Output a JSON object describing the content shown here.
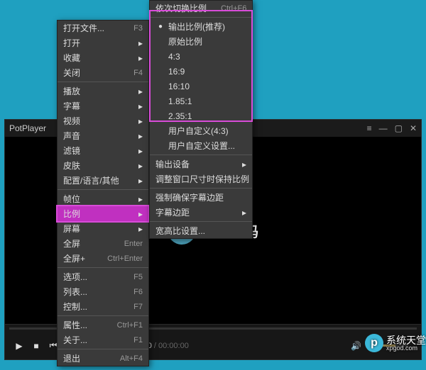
{
  "player": {
    "title": "PotPlayer",
    "logo_text": "完美解码",
    "time_current": "00:00:00",
    "time_duration": "00:00:00"
  },
  "menu1": {
    "items": [
      {
        "label": "打开文件...",
        "shortcut": "F3"
      },
      {
        "label": "打开",
        "submenu": true
      },
      {
        "label": "收藏",
        "submenu": true
      },
      {
        "label": "关闭",
        "shortcut": "F4"
      }
    ],
    "items2": [
      {
        "label": "播放",
        "submenu": true
      },
      {
        "label": "字幕",
        "submenu": true
      },
      {
        "label": "视频",
        "submenu": true
      },
      {
        "label": "声音",
        "submenu": true
      },
      {
        "label": "滤镜",
        "submenu": true
      },
      {
        "label": "皮肤",
        "submenu": true
      },
      {
        "label": "配置/语言/其他",
        "submenu": true
      }
    ],
    "items3": [
      {
        "label": "帧位",
        "submenu": true
      },
      {
        "label": "比例",
        "submenu": true,
        "highlight": true
      },
      {
        "label": "屏幕",
        "submenu": true
      },
      {
        "label": "全屏",
        "shortcut": "Enter"
      },
      {
        "label": "全屏+",
        "shortcut": "Ctrl+Enter"
      }
    ],
    "items4": [
      {
        "label": "选项...",
        "shortcut": "F5"
      },
      {
        "label": "列表...",
        "shortcut": "F6"
      },
      {
        "label": "控制...",
        "shortcut": "F7"
      }
    ],
    "items5": [
      {
        "label": "属性...",
        "shortcut": "Ctrl+F1"
      },
      {
        "label": "关于...",
        "shortcut": "F1"
      }
    ],
    "items6": [
      {
        "label": "退出",
        "shortcut": "Alt+F4"
      }
    ]
  },
  "menu2": {
    "top_item": {
      "label": "依次切换比例",
      "shortcut": "Ctrl+F6"
    },
    "ratio_items": [
      {
        "label": "输出比例(推荐)",
        "checked": true
      },
      {
        "label": "原始比例"
      },
      {
        "label": "4:3"
      },
      {
        "label": "16:9"
      },
      {
        "label": "16:10"
      },
      {
        "label": "1.85:1"
      },
      {
        "label": "2.35:1"
      },
      {
        "label": "用户自定义(4:3)"
      },
      {
        "label": "用户自定义设置..."
      }
    ],
    "bottom_items": [
      {
        "label": "输出设备",
        "submenu": true
      },
      {
        "label": "调整窗口尺寸时保持比例"
      },
      {
        "label": "强制确保字幕边距"
      },
      {
        "label": "字幕边距",
        "submenu": true
      },
      {
        "label": "宽高比设置..."
      }
    ]
  },
  "watermark": {
    "brand": "系统天堂",
    "url": "xpgod.com",
    "badge": "p"
  }
}
